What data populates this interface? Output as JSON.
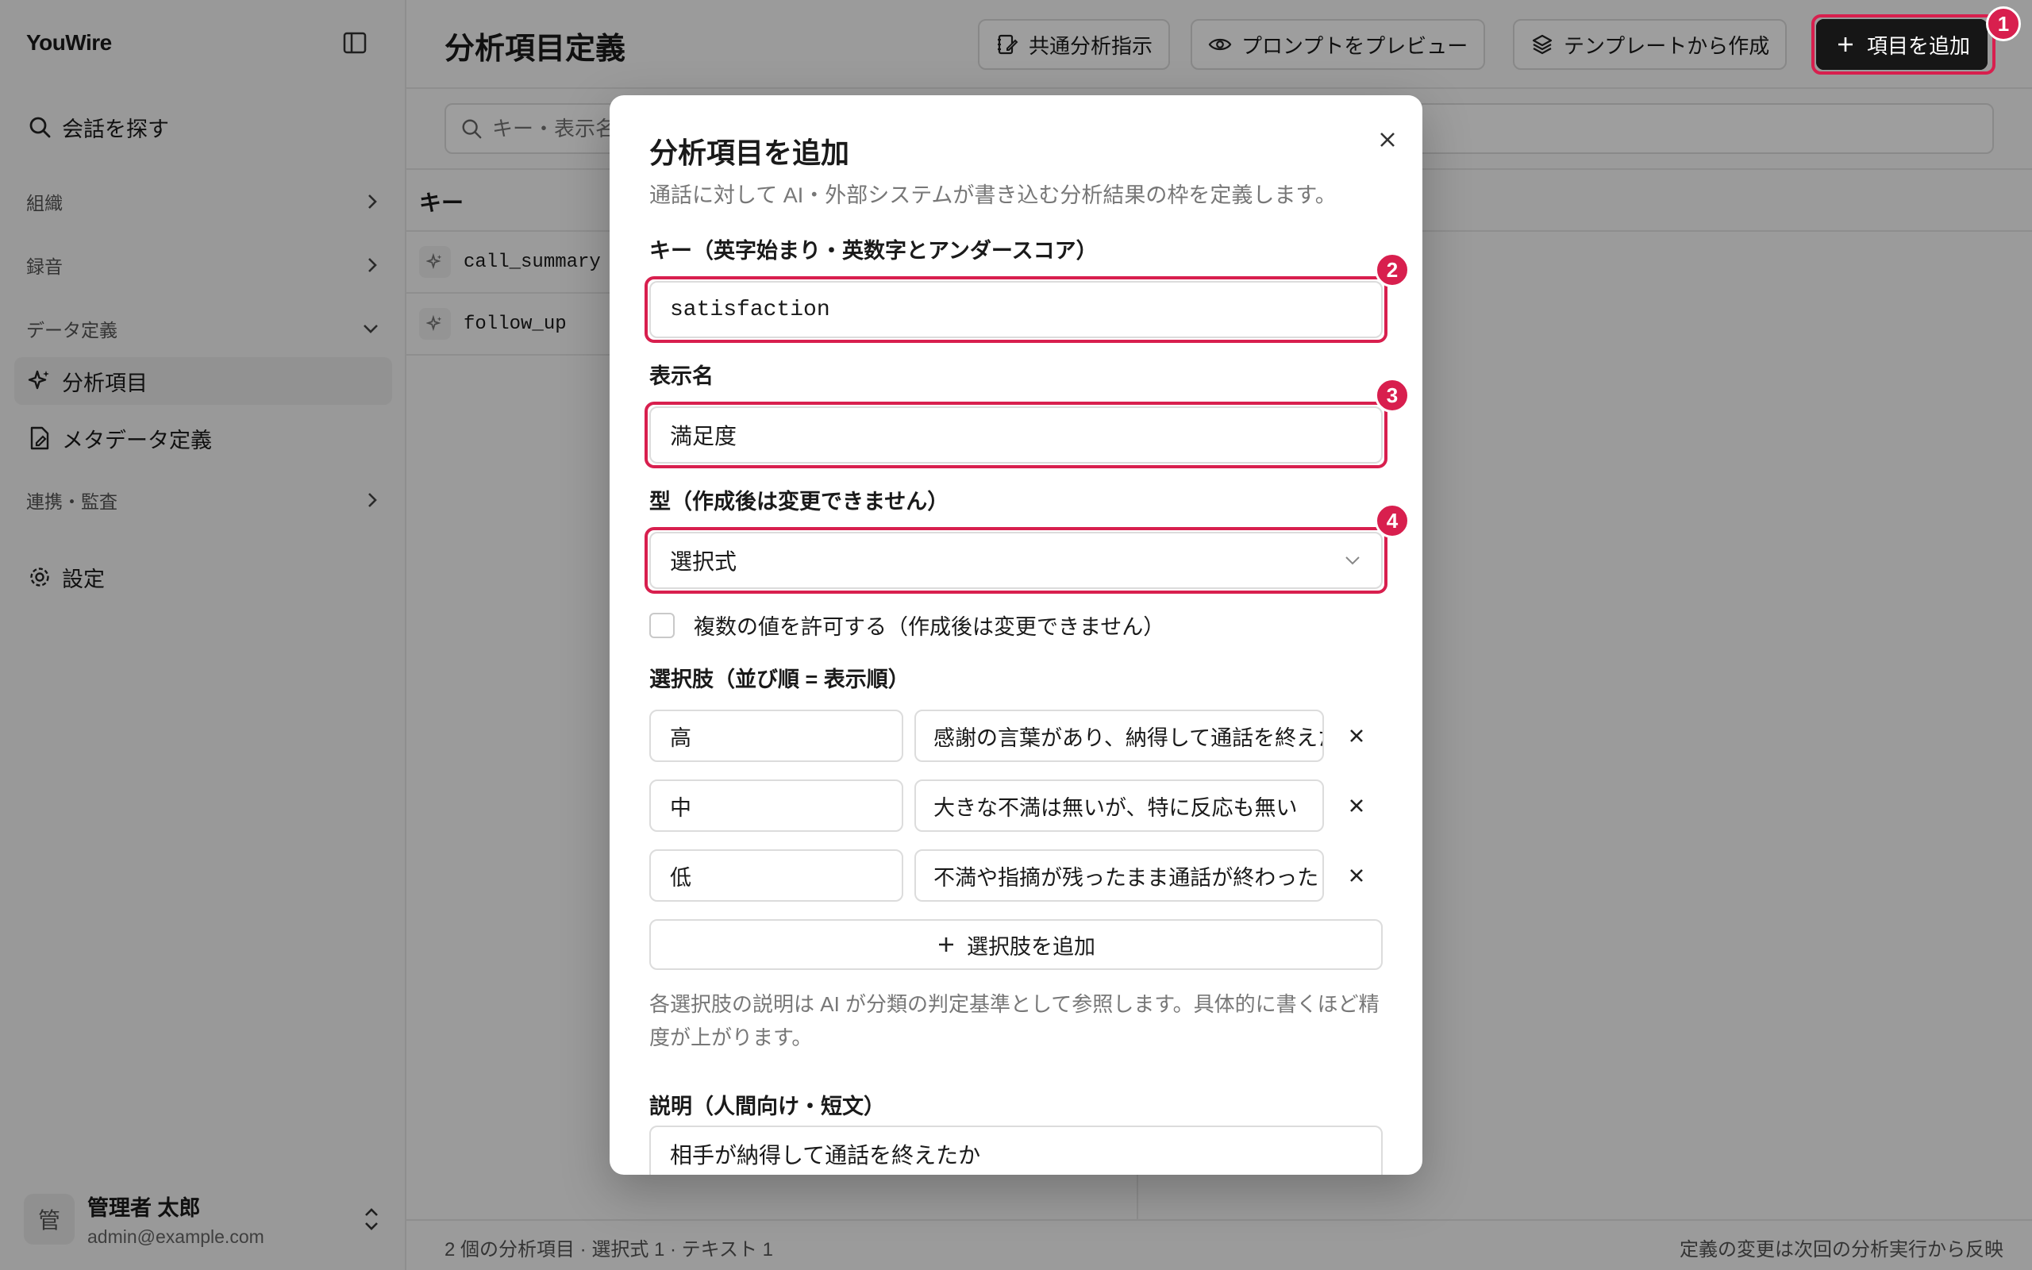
{
  "sidebar": {
    "brand": "YouWire",
    "toggle_icon": "sidebar-panel-icon",
    "search_label": "会話を探す",
    "sections": [
      {
        "label": "組織",
        "state": "collapsed"
      },
      {
        "label": "録音",
        "state": "collapsed"
      },
      {
        "label": "データ定義",
        "state": "expanded"
      },
      {
        "label": "連携・監査",
        "state": "collapsed"
      }
    ],
    "items": [
      {
        "label": "分析項目",
        "icon": "sparkles-icon",
        "active": true
      },
      {
        "label": "メタデータ定義",
        "icon": "file-edit-icon",
        "active": false
      }
    ],
    "settings_label": "設定",
    "user": {
      "avatar_text": "管",
      "name": "管理者 太郎",
      "email": "admin@example.com"
    }
  },
  "header": {
    "title": "分析項目定義",
    "buttons": {
      "common_instructions": "共通分析指示",
      "preview_prompt": "プロンプトをプレビュー",
      "from_template": "テンプレートから作成",
      "add_item": "項目を追加"
    }
  },
  "search": {
    "placeholder": "キー・表示名で検索"
  },
  "table": {
    "header_key": "キー",
    "rows": [
      {
        "key": "call_summary",
        "icon": "sparkles-icon"
      },
      {
        "key": "follow_up",
        "icon": "sparkles-icon"
      }
    ]
  },
  "footer": {
    "summary": "2 個の分析項目 · 選択式 1 · テキスト 1",
    "note": "定義の変更は次回の分析実行から反映"
  },
  "modal": {
    "title": "分析項目を追加",
    "description": "通話に対して AI・外部システムが書き込む分析結果の枠を定義します。",
    "key_label": "キー（英字始まり・英数字とアンダースコア）",
    "key_value": "satisfaction",
    "display_name_label": "表示名",
    "display_name_value": "満足度",
    "type_label": "型（作成後は変更できません）",
    "type_value": "選択式",
    "multi_label": "複数の値を許可する（作成後は変更できません）",
    "multi_checked": false,
    "options_label": "選択肢（並び順 = 表示順）",
    "options": [
      {
        "label": "高",
        "description": "感謝の言葉があり、納得して通話を終えた"
      },
      {
        "label": "中",
        "description": "大きな不満は無いが、特に反応も無い"
      },
      {
        "label": "低",
        "description": "不満や指摘が残ったまま通話が終わった"
      }
    ],
    "add_option_label": "選択肢を追加",
    "options_hint": "各選択肢の説明は AI が分類の判定基準として参照します。具体的に書くほど精度が上がります。",
    "explanation_label": "説明（人間向け・短文）",
    "explanation_value": "相手が納得して通話を終えたか"
  },
  "annotations": {
    "color": "#d81f4e",
    "badges": [
      "1",
      "2",
      "3",
      "4"
    ]
  }
}
